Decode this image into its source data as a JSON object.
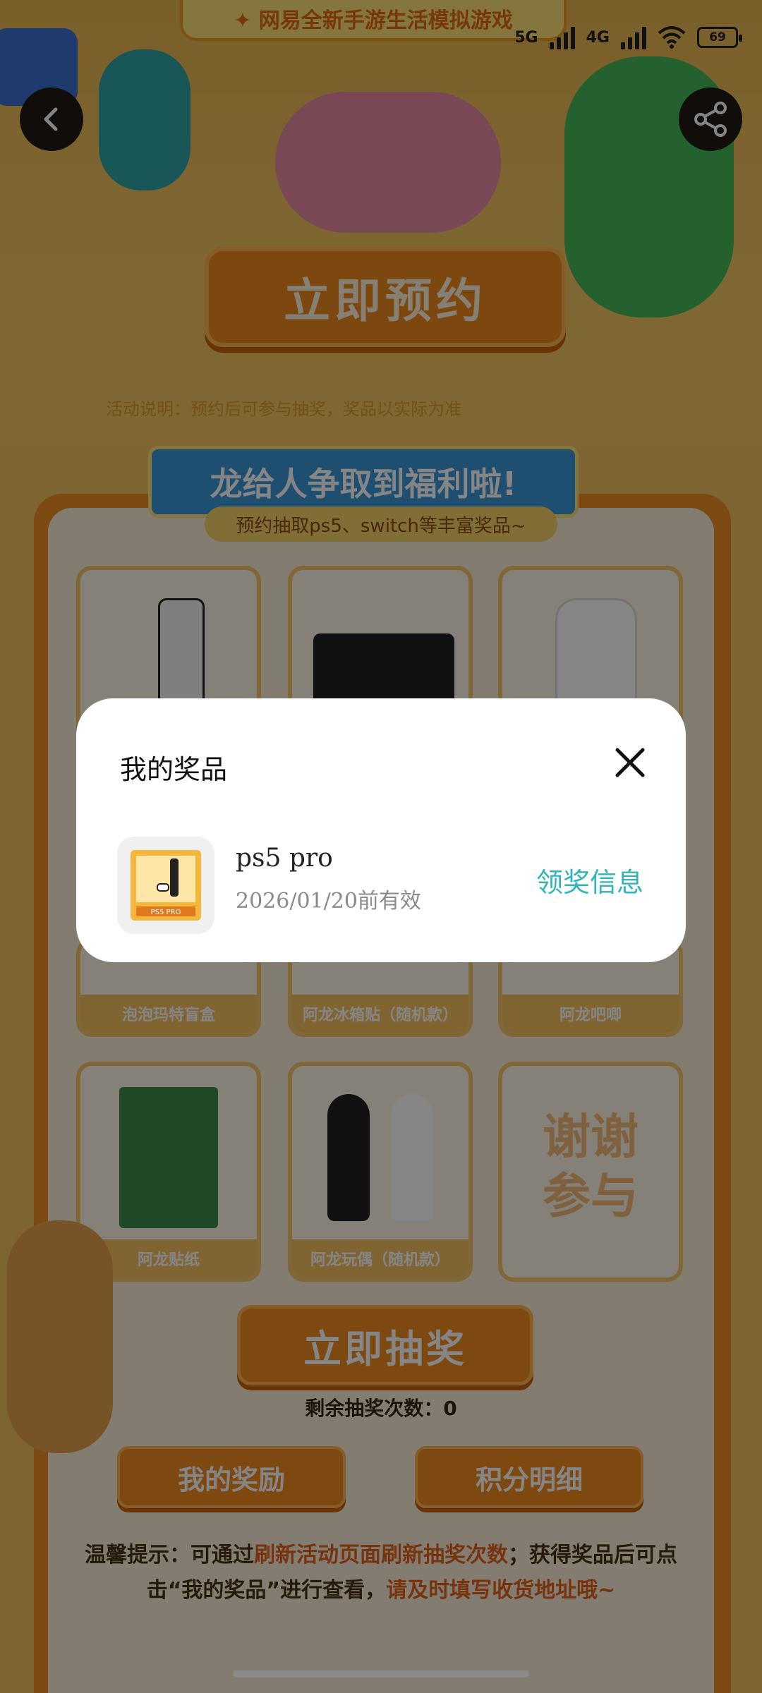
{
  "status_bar": {
    "signal1": "5G",
    "signal2": "4G",
    "battery": "69"
  },
  "nav": {
    "back": "chevron-left-icon",
    "share": "share-icon"
  },
  "hero": {
    "banner": "✦ 网易全新手游生活模拟游戏",
    "reserve_button": "立即预约",
    "notice": "活动说明：预约后可参与抽奖，奖品以实际为准"
  },
  "card": {
    "ribbon_title": "龙给人争取到福利啦!",
    "ribbon_subtitle": "预约抽取ps5、switch等丰富奖品~",
    "prizes_row3": [
      "泡泡玛特盲盒",
      "阿龙冰箱贴（随机款）",
      "阿龙吧唧"
    ],
    "prizes_row4": [
      "阿龙贴纸",
      "阿龙玩偶（随机款）"
    ],
    "thanks_text": "谢谢参与",
    "draw_button": "立即抽奖",
    "remaining_label": "剩余抽奖次数：",
    "remaining_count": "0",
    "my_rewards_button": "我的奖励",
    "points_button": "积分明细",
    "tip_part1": "温馨提示：可通过",
    "tip_hl1": "刷新活动页面刷新抽奖次数",
    "tip_part2": "；获得奖品后可点击“我的奖品”进行查看，",
    "tip_hl2": "请及时填写收货地址哦~"
  },
  "modal": {
    "title": "我的奖品",
    "close_icon": "close-icon",
    "item": {
      "name": "ps5 pro",
      "expiry": "2026/01/20前有效",
      "thumb_caption": "PS5 PRO",
      "claim_label": "领奖信息"
    }
  },
  "colors": {
    "accent": "#f28a22",
    "link": "#2fb5b8",
    "overlay": "rgba(0,0,0,0.48)"
  }
}
